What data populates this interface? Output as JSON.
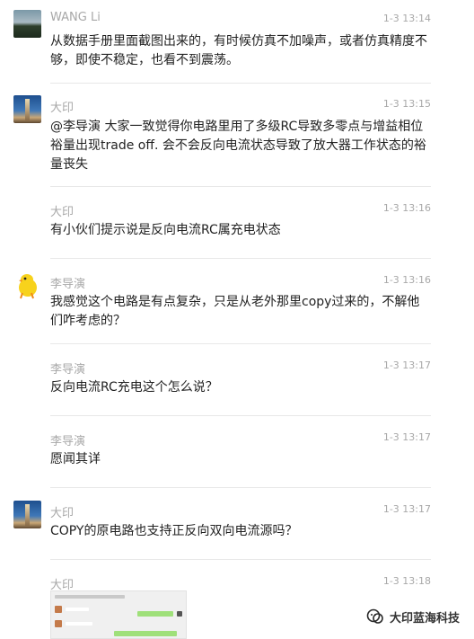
{
  "messages": [
    {
      "sender": "WANG Li",
      "time": "1-3 13:14",
      "text": "从数据手册里面截图出来的，有时候仿真不加噪声，或者仿真精度不够，即使不稳定，也看不到震荡。",
      "avatar_icon": "landscape-avatar"
    },
    {
      "sender": "大印",
      "time": "1-3 13:15",
      "text": "@李导演 大家一致觉得你电路里用了多级RC导致多零点与增益相位裕量出现trade off. 会不会反向电流状态导致了放大器工作状态的裕量丧失",
      "avatar_icon": "tower-avatar"
    },
    {
      "sender": "大印",
      "time": "1-3 13:16",
      "text": "有小伙们提示说是反向电流RC属充电状态"
    },
    {
      "sender": "李导演",
      "time": "1-3 13:16",
      "text": "我感觉这个电路是有点复杂，只是从老外那里copy过来的，不解他们咋考虑的？",
      "avatar_icon": "chick-avatar"
    },
    {
      "sender": "李导演",
      "time": "1-3 13:17",
      "text": "反向电流RC充电这个怎么说？"
    },
    {
      "sender": "李导演",
      "time": "1-3 13:17",
      "text": "愿闻其详"
    },
    {
      "sender": "大印",
      "time": "1-3 13:17",
      "text": "COPY的原电路也支持正反向双向电流源吗？",
      "avatar_icon": "tower-avatar"
    },
    {
      "sender": "大印",
      "time": "1-3 13:18",
      "text": ""
    }
  ],
  "watermark": {
    "label": "大印蓝海科技",
    "icon": "wechat-official-account-icon"
  },
  "colors": {
    "meta": "#a8a8a8",
    "text": "#222222",
    "divider": "#e8e8e8"
  }
}
